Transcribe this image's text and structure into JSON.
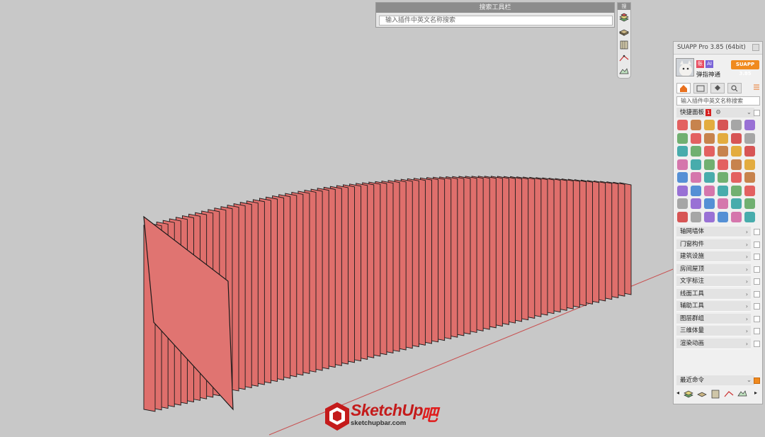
{
  "search_toolbar": {
    "title": "搜索工具栏",
    "placeholder": "输入插件中英文名称搜索"
  },
  "icon_strip": {
    "head_label": "搜",
    "icons": [
      "plugin-layers-icon",
      "plugin-building-icon",
      "plugin-wall-icon",
      "plugin-curve-icon",
      "plugin-terrain-icon"
    ]
  },
  "suapp": {
    "window_title": "SUAPP Pro 3.85 (64bit)",
    "user": {
      "name": "弹指神通",
      "badge_1": "账",
      "badge_2": "AI",
      "version_button": "SUAPP 3.85"
    },
    "tabs": [
      "home-tab-icon",
      "list-tab-icon",
      "paint-tab-icon",
      "search-tab-icon"
    ],
    "search_placeholder": "输入插件中英文名称搜索",
    "quick_panel": {
      "label": "快捷面板",
      "count": "1"
    },
    "categories": [
      "轴网墙体",
      "门窗构件",
      "建筑设施",
      "房间屋顶",
      "文字标注",
      "线面工具",
      "辅助工具",
      "图层群组",
      "三维体量",
      "渲染动画"
    ],
    "recent": {
      "label": "最近命令"
    }
  },
  "watermark": {
    "brand": "SketchUp",
    "bar": "吧",
    "url": "sketchupbar.com"
  },
  "colors": {
    "viewport_bg": "#c8c8c8",
    "slab_fill": "#df6f6c",
    "accent_orange": "#f08a1e",
    "brand_red": "#c41b1b"
  }
}
